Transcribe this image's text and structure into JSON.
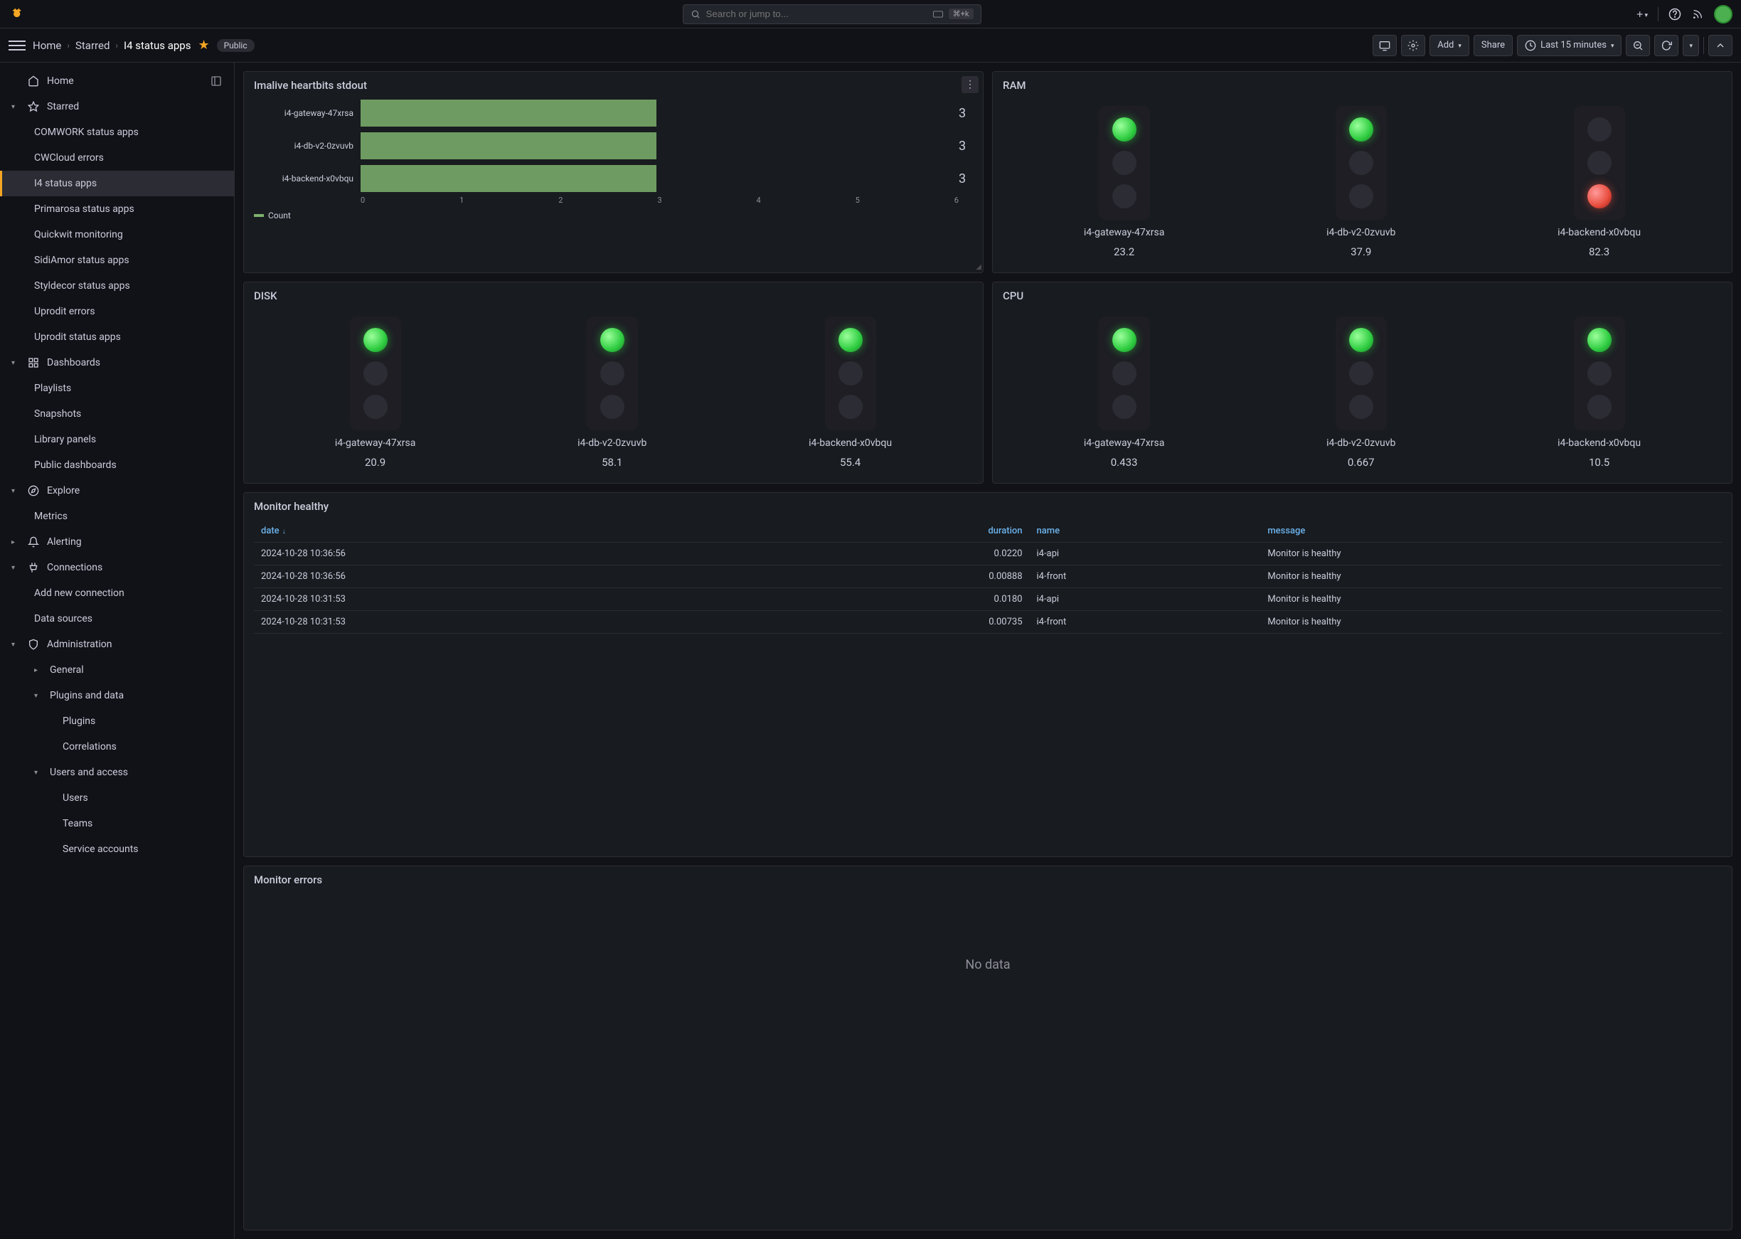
{
  "topbar": {
    "search_placeholder": "Search or jump to...",
    "shortcut": "⌘+k"
  },
  "breadcrumb": {
    "home": "Home",
    "starred": "Starred",
    "current": "I4 status apps"
  },
  "header": {
    "badge": "Public",
    "add": "Add",
    "share": "Share",
    "timerange": "Last 15 minutes"
  },
  "sidebar": {
    "home": "Home",
    "starred": "Starred",
    "starred_items": [
      "COMWORK status apps",
      "CWCloud errors",
      "I4 status apps",
      "Primarosa status apps",
      "Quickwit monitoring",
      "SidiAmor status apps",
      "Styldecor status apps",
      "Uprodit errors",
      "Uprodit status apps"
    ],
    "dashboards": "Dashboards",
    "dashboards_items": [
      "Playlists",
      "Snapshots",
      "Library panels",
      "Public dashboards"
    ],
    "explore": "Explore",
    "metrics": "Metrics",
    "alerting": "Alerting",
    "connections": "Connections",
    "connections_items": [
      "Add new connection",
      "Data sources"
    ],
    "administration": "Administration",
    "general": "General",
    "plugins_data": "Plugins and data",
    "plugins_items": [
      "Plugins",
      "Correlations"
    ],
    "users_access": "Users and access",
    "users_items": [
      "Users",
      "Teams",
      "Service accounts"
    ]
  },
  "panels": {
    "heartbits": "Imalive heartbits stdout",
    "ram": "RAM",
    "disk": "DISK",
    "cpu": "CPU",
    "monitor_healthy": "Monitor healthy",
    "monitor_errors": "Monitor errors",
    "no_data": "No data",
    "legend": "Count"
  },
  "chart_data": {
    "type": "bar",
    "categories": [
      "i4-gateway-47xrsa",
      "i4-db-v2-0zvuvb",
      "i4-backend-x0vbqu"
    ],
    "values": [
      3,
      3,
      3
    ],
    "xlim": [
      0,
      6
    ],
    "ticks": [
      "0",
      "1",
      "2",
      "3",
      "4",
      "5",
      "6"
    ],
    "legend": "Count"
  },
  "ram": [
    {
      "name": "i4-gateway-47xrsa",
      "value": "23.2",
      "status": "green"
    },
    {
      "name": "i4-db-v2-0zvuvb",
      "value": "37.9",
      "status": "green"
    },
    {
      "name": "i4-backend-x0vbqu",
      "value": "82.3",
      "status": "red"
    }
  ],
  "disk": [
    {
      "name": "i4-gateway-47xrsa",
      "value": "20.9",
      "status": "green"
    },
    {
      "name": "i4-db-v2-0zvuvb",
      "value": "58.1",
      "status": "green"
    },
    {
      "name": "i4-backend-x0vbqu",
      "value": "55.4",
      "status": "green"
    }
  ],
  "cpu": [
    {
      "name": "i4-gateway-47xrsa",
      "value": "0.433",
      "status": "green"
    },
    {
      "name": "i4-db-v2-0zvuvb",
      "value": "0.667",
      "status": "green"
    },
    {
      "name": "i4-backend-x0vbqu",
      "value": "10.5",
      "status": "green"
    }
  ],
  "table": {
    "columns": {
      "date": "date",
      "duration": "duration",
      "name": "name",
      "message": "message"
    },
    "rows": [
      {
        "date": "2024-10-28 10:36:56",
        "duration": "0.0220",
        "name": "i4-api",
        "message": "Monitor is healthy"
      },
      {
        "date": "2024-10-28 10:36:56",
        "duration": "0.00888",
        "name": "i4-front",
        "message": "Monitor is healthy"
      },
      {
        "date": "2024-10-28 10:31:53",
        "duration": "0.0180",
        "name": "i4-api",
        "message": "Monitor is healthy"
      },
      {
        "date": "2024-10-28 10:31:53",
        "duration": "0.00735",
        "name": "i4-front",
        "message": "Monitor is healthy"
      }
    ]
  }
}
